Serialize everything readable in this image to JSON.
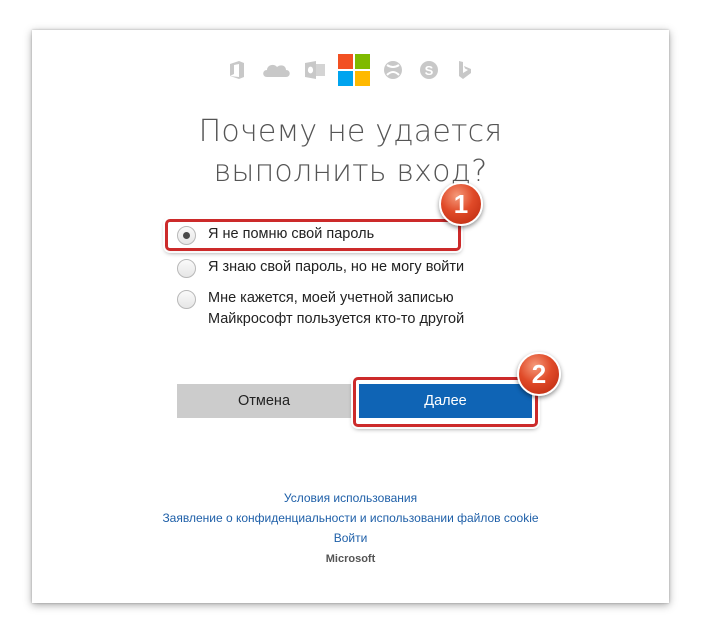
{
  "heading": {
    "line1": "Почему не удается",
    "line2": "выполнить вход?"
  },
  "brand_icons": [
    "office-icon",
    "onedrive-icon",
    "outlook-icon",
    "microsoft-logo",
    "xbox-icon",
    "skype-icon",
    "bing-icon"
  ],
  "options": [
    {
      "label": "Я не помню свой пароль",
      "checked": true
    },
    {
      "label": "Я знаю свой пароль, но не могу войти",
      "checked": false
    },
    {
      "label_line1": "Мне кажется, моей учетной записью",
      "label_line2": "Майкрософт пользуется кто-то другой",
      "checked": false
    }
  ],
  "buttons": {
    "cancel": "Отмена",
    "next": "Далее"
  },
  "badges": {
    "step1": "1",
    "step2": "2"
  },
  "footer": {
    "terms": "Условия использования",
    "privacy": "Заявление о конфиденциальности и использовании файлов cookie",
    "signin": "Войти",
    "brand": "Microsoft"
  },
  "colors": {
    "accent": "#0f64b5",
    "highlight": "#cc2a2a",
    "badge": "#e04a28",
    "link": "#1e5fa8"
  }
}
